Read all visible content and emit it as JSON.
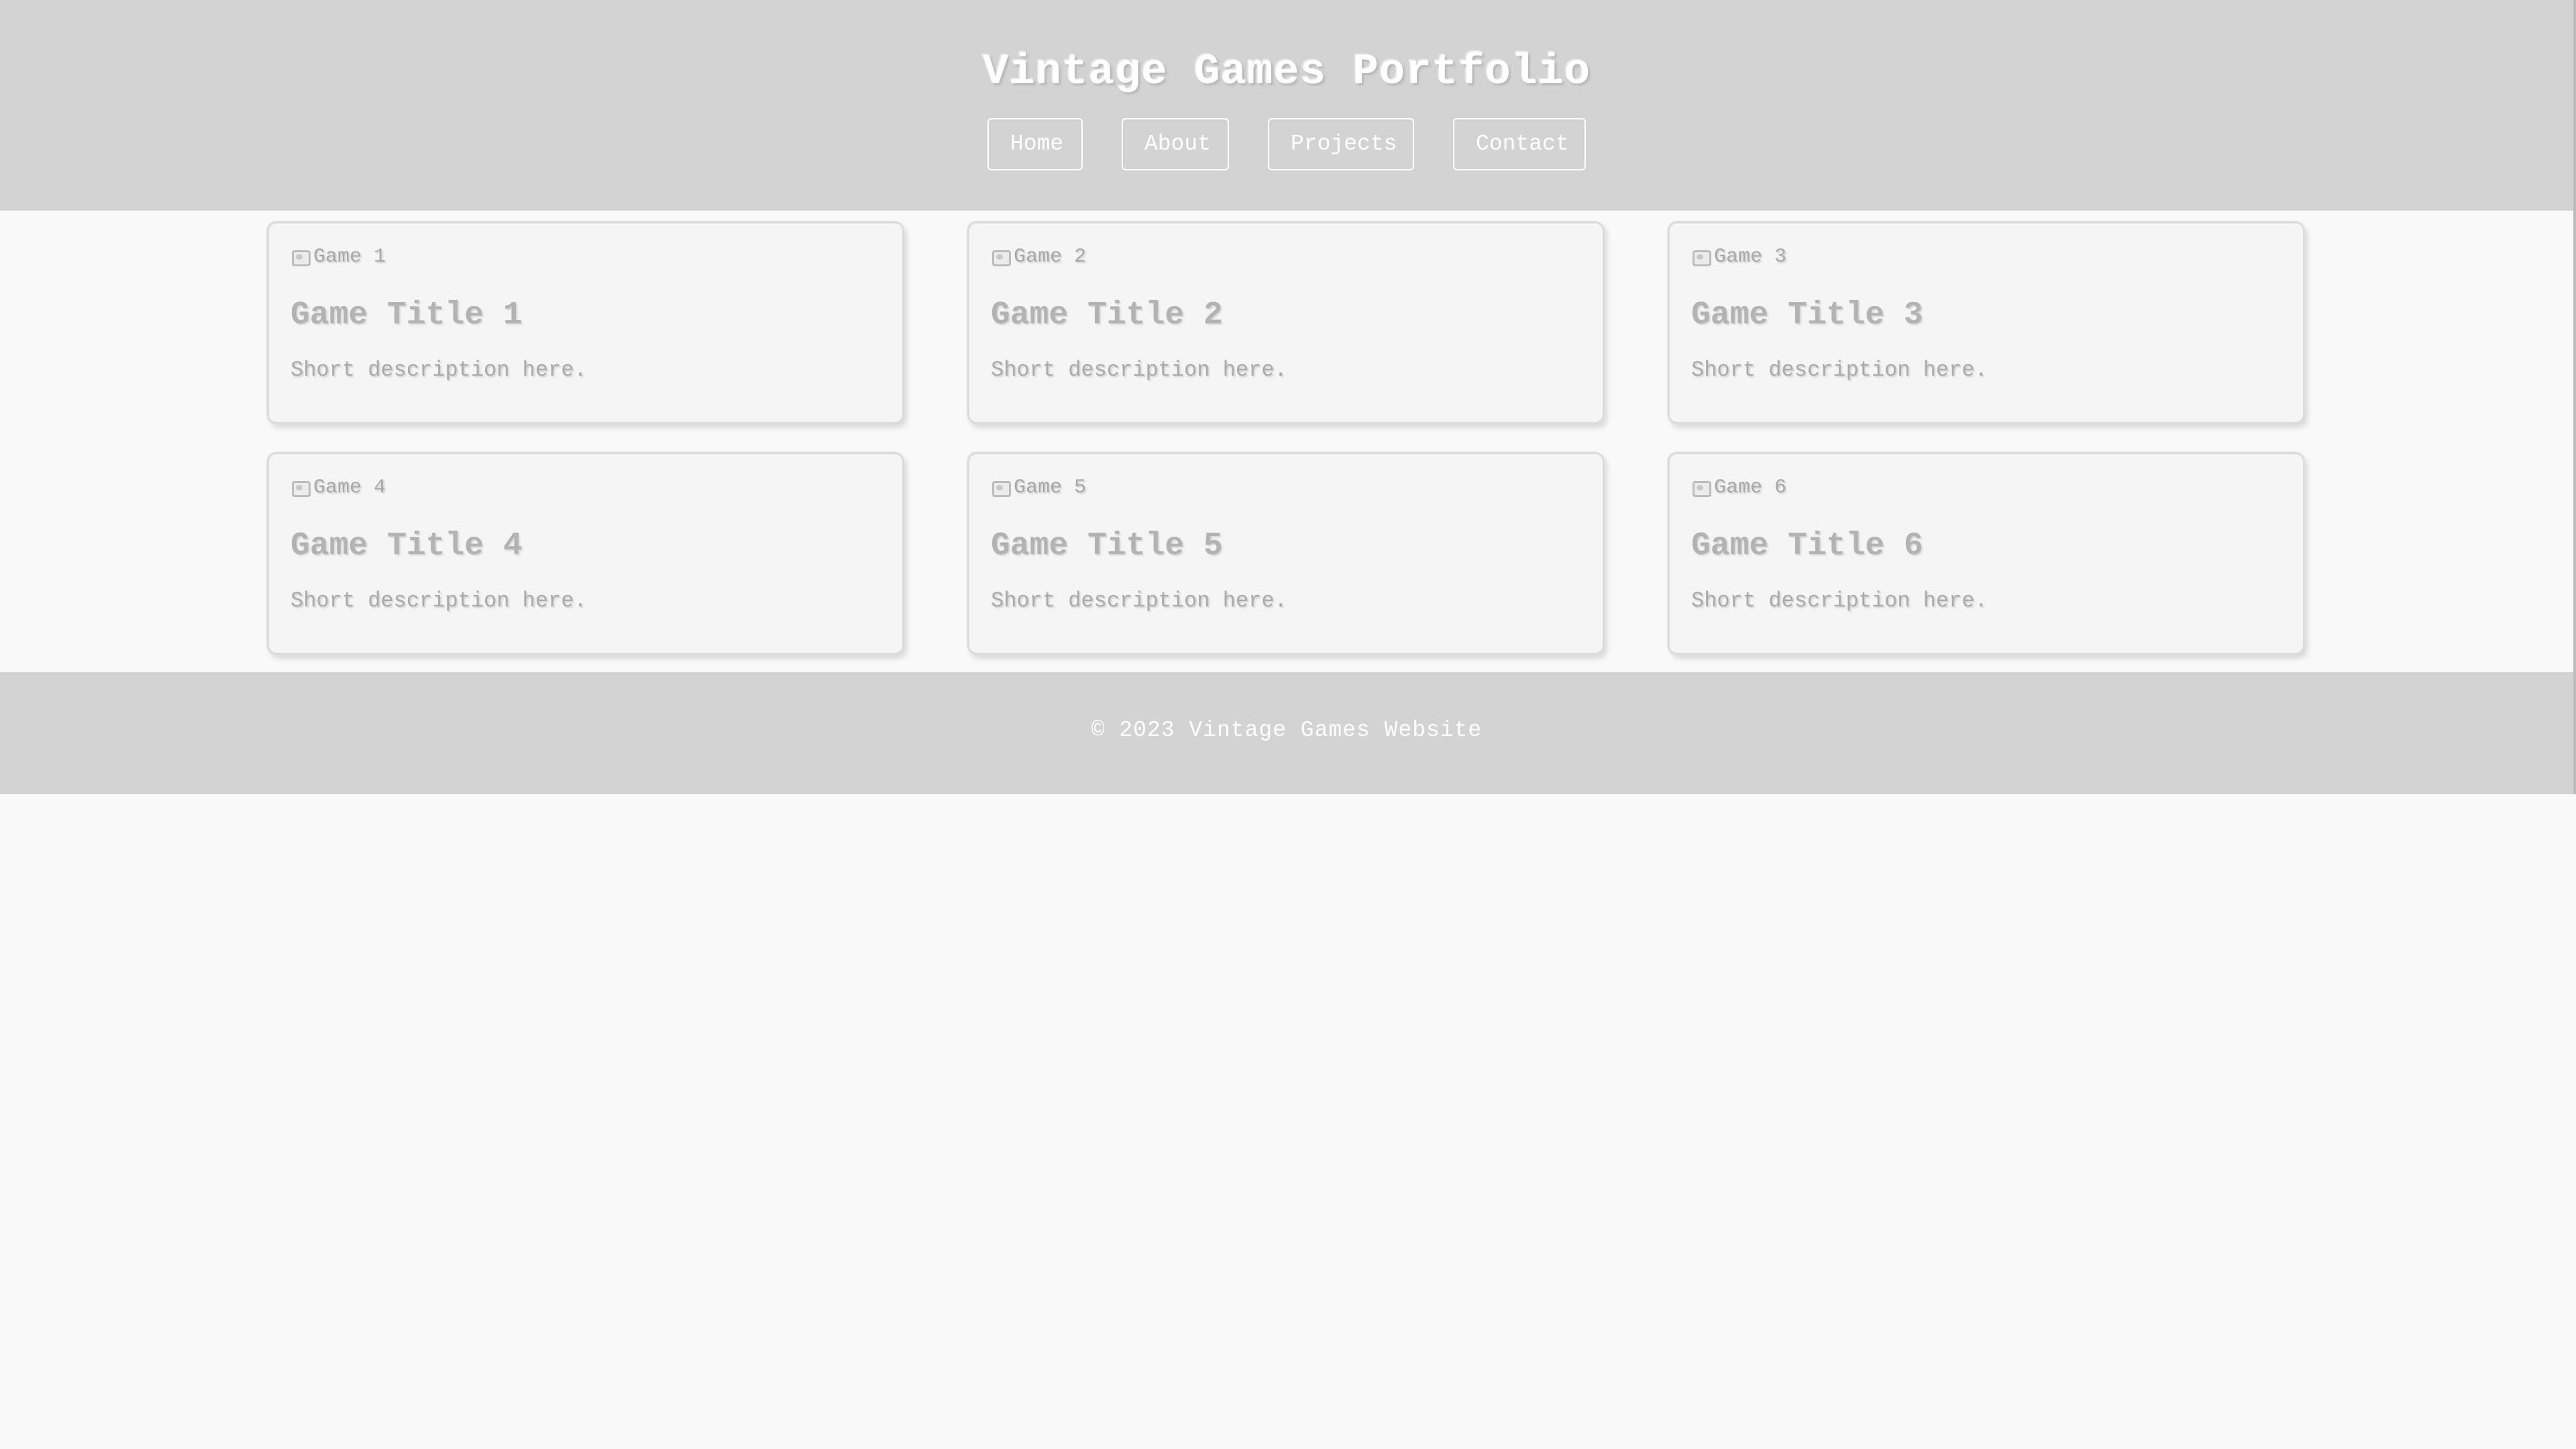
{
  "header": {
    "title": "Vintage Games Portfolio",
    "nav": [
      {
        "label": "Home"
      },
      {
        "label": "About"
      },
      {
        "label": "Projects"
      },
      {
        "label": "Contact"
      }
    ]
  },
  "cards": [
    {
      "image_alt": "Game 1",
      "title": "Game Title 1",
      "description": "Short description here."
    },
    {
      "image_alt": "Game 2",
      "title": "Game Title 2",
      "description": "Short description here."
    },
    {
      "image_alt": "Game 3",
      "title": "Game Title 3",
      "description": "Short description here."
    },
    {
      "image_alt": "Game 4",
      "title": "Game Title 4",
      "description": "Short description here."
    },
    {
      "image_alt": "Game 5",
      "title": "Game Title 5",
      "description": "Short description here."
    },
    {
      "image_alt": "Game 6",
      "title": "Game Title 6",
      "description": "Short description here."
    }
  ],
  "footer": {
    "text": "© 2023 Vintage Games Website"
  },
  "colors": {
    "header_bg": "#d3d3d3",
    "page_bg": "#f9f9f9",
    "card_bg": "#f5f5f5",
    "nav_text": "#ffffff"
  },
  "icons": {
    "card_image": "broken-image-icon"
  }
}
